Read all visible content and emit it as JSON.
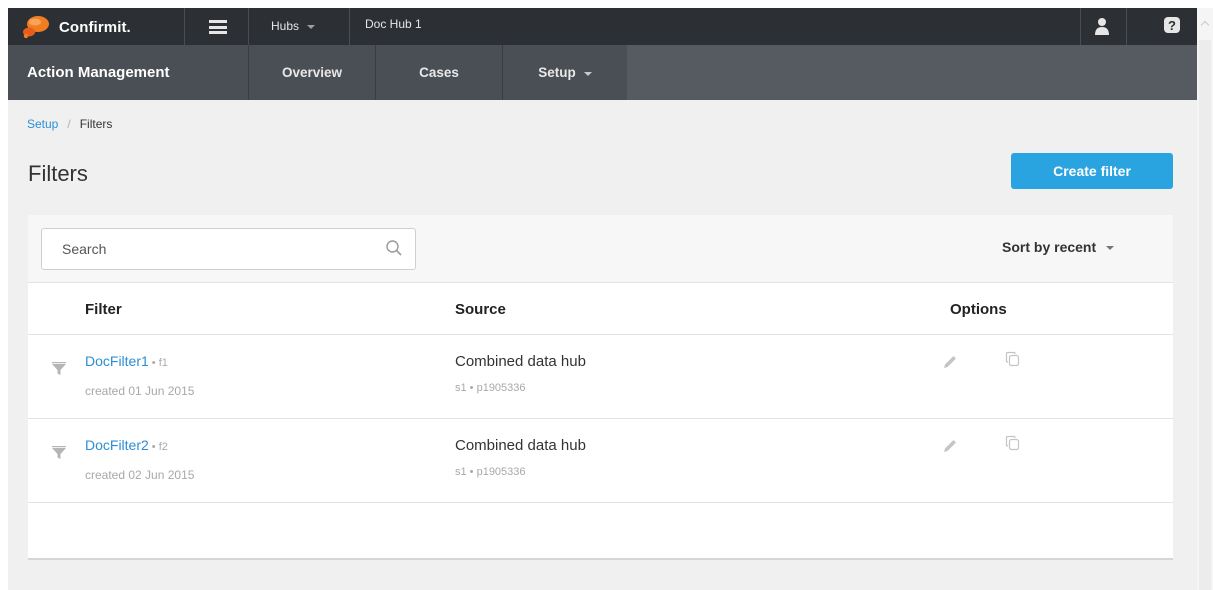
{
  "topbar": {
    "brand": "Confirmit.",
    "hubs_label": "Hubs",
    "hub_name": "Doc Hub 1"
  },
  "subnav": {
    "title": "Action Management",
    "tabs": [
      {
        "label": "Overview"
      },
      {
        "label": "Cases"
      },
      {
        "label": "Setup"
      }
    ]
  },
  "breadcrumb": {
    "parent": "Setup",
    "separator": "/",
    "current": "Filters"
  },
  "page": {
    "title": "Filters",
    "create_button": "Create filter"
  },
  "toolbar": {
    "search_placeholder": "Search",
    "sort_label": "Sort by recent"
  },
  "table": {
    "columns": [
      "Filter",
      "Source",
      "Options"
    ],
    "rows": [
      {
        "name": "DocFilter1",
        "id": "• f1",
        "created": "created 01 Jun 2015",
        "source": "Combined data hub",
        "source_ids": "s1 • p1905336"
      },
      {
        "name": "DocFilter2",
        "id": "• f2",
        "created": "created 02 Jun 2015",
        "source": "Combined data hub",
        "source_ids": "s1 • p1905336"
      }
    ]
  },
  "colors": {
    "topbar": "#2c2f33",
    "subnav": "#4a4e55",
    "accent": "#2aa3e1",
    "link": "#2a8fd6"
  }
}
